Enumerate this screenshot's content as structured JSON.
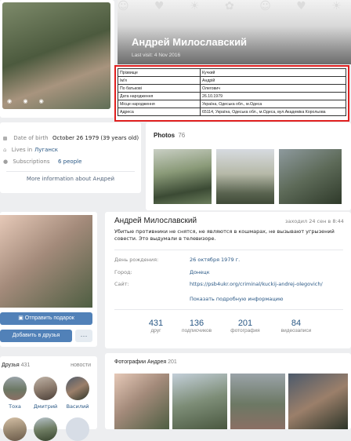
{
  "top_profile": {
    "name": "Андрей Милославский",
    "last_visit": "Last visit: 4 Nov 2016",
    "table": [
      [
        "Прізвище",
        "Кучкий"
      ],
      [
        "Ім'я",
        "Андрій"
      ],
      [
        "По батькові",
        "Олегович"
      ],
      [
        "Дата народження",
        "26.10.1979"
      ],
      [
        "Місце народження",
        "Україна, Одеська обл., м.Одеса"
      ],
      [
        "Адреса",
        "65114, Україна, Одеська обл., м.Одеса, вул.Академіка Корольова"
      ]
    ],
    "details": {
      "dob_label": "Date of birth",
      "dob_value": "October 26 1979 (39 years old)",
      "lives_label": "Lives in",
      "lives_value": "Луганск",
      "subs_label": "Subscriptions",
      "subs_value": "6 people",
      "more": "More information about Андрей"
    },
    "photos": {
      "title": "Photos",
      "count": "76"
    }
  },
  "bottom_profile": {
    "name": "Андрей Милославский",
    "status_time": "заходил 24 сен в 8:44",
    "status": "Убитые противники не снятся, не являются в кошмарах, не вызывают угрызений совести. Это выдумали в телевизоре.",
    "fields": [
      {
        "label": "День рождения:",
        "value": "26 октября 1979 г."
      },
      {
        "label": "Город:",
        "value": "Донецк"
      },
      {
        "label": "Сайт:",
        "value": "https://psb4ukr.org/criminal/kuckij-andrej-olegovich/"
      }
    ],
    "show_more": "Показать подробную информацию",
    "stats": [
      {
        "num": "431",
        "label": "друг"
      },
      {
        "num": "136",
        "label": "подписчиков"
      },
      {
        "num": "201",
        "label": "фотография"
      },
      {
        "num": "84",
        "label": "видеозаписи"
      }
    ],
    "send_gift": "Отправить подарок",
    "add_friend": "Добавить в друзья",
    "more_dots": "···",
    "friends": {
      "title": "Друзья",
      "count": "431",
      "news": "новости",
      "names": [
        "Тоха",
        "Дмитрий",
        "Василий"
      ]
    },
    "photos": {
      "title": "Фотографии Андрея",
      "count": "201"
    }
  },
  "colors": {
    "accent": "#5181b8",
    "link": "#2a5885",
    "highlight": "#e02020"
  }
}
